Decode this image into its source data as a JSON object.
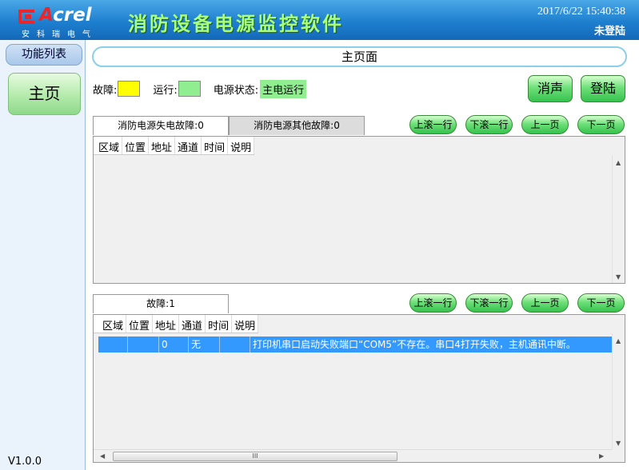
{
  "header": {
    "logo_name": "Acrel",
    "logo_sub": "安科瑞电气",
    "app_title": "消防设备电源监控软件",
    "datetime": "2017/6/22 15:40:38",
    "login_status": "未登陆"
  },
  "sidebar": {
    "title": "功能列表",
    "items": [
      {
        "label": "主页"
      }
    ],
    "version": "V1.0.0"
  },
  "main": {
    "page_title": "主页面",
    "status": {
      "fault_label": "故障:",
      "run_label": "运行:",
      "power_label": "电源状态:",
      "power_value": "主电运行",
      "fault_color": "#ffff00",
      "run_color": "#90ee90"
    },
    "buttons": {
      "mute": "消声",
      "login": "登陆"
    },
    "nav_buttons": {
      "scroll_up": "上滚一行",
      "scroll_down": "下滚一行",
      "page_up": "上一页",
      "page_down": "下一页"
    },
    "top_panel": {
      "tabs": [
        {
          "label": "消防电源失电故障:0",
          "active": true
        },
        {
          "label": "消防电源其他故障:0",
          "active": false
        }
      ],
      "columns": [
        "区域",
        "位置",
        "地址",
        "通道",
        "时间",
        "说明"
      ],
      "rows": []
    },
    "bottom_panel": {
      "tabs": [
        {
          "label": "故障:1",
          "active": true
        }
      ],
      "columns": [
        "区域",
        "位置",
        "地址",
        "通道",
        "时间",
        "说明"
      ],
      "rows": [
        {
          "region": "",
          "position": "",
          "address": "0",
          "channel": "无",
          "time": "",
          "description": "打印机串口启动失败端口“COM5”不存在。串口4打开失败，主机通讯中断。"
        }
      ],
      "scroll_thumb_label": "III"
    }
  }
}
